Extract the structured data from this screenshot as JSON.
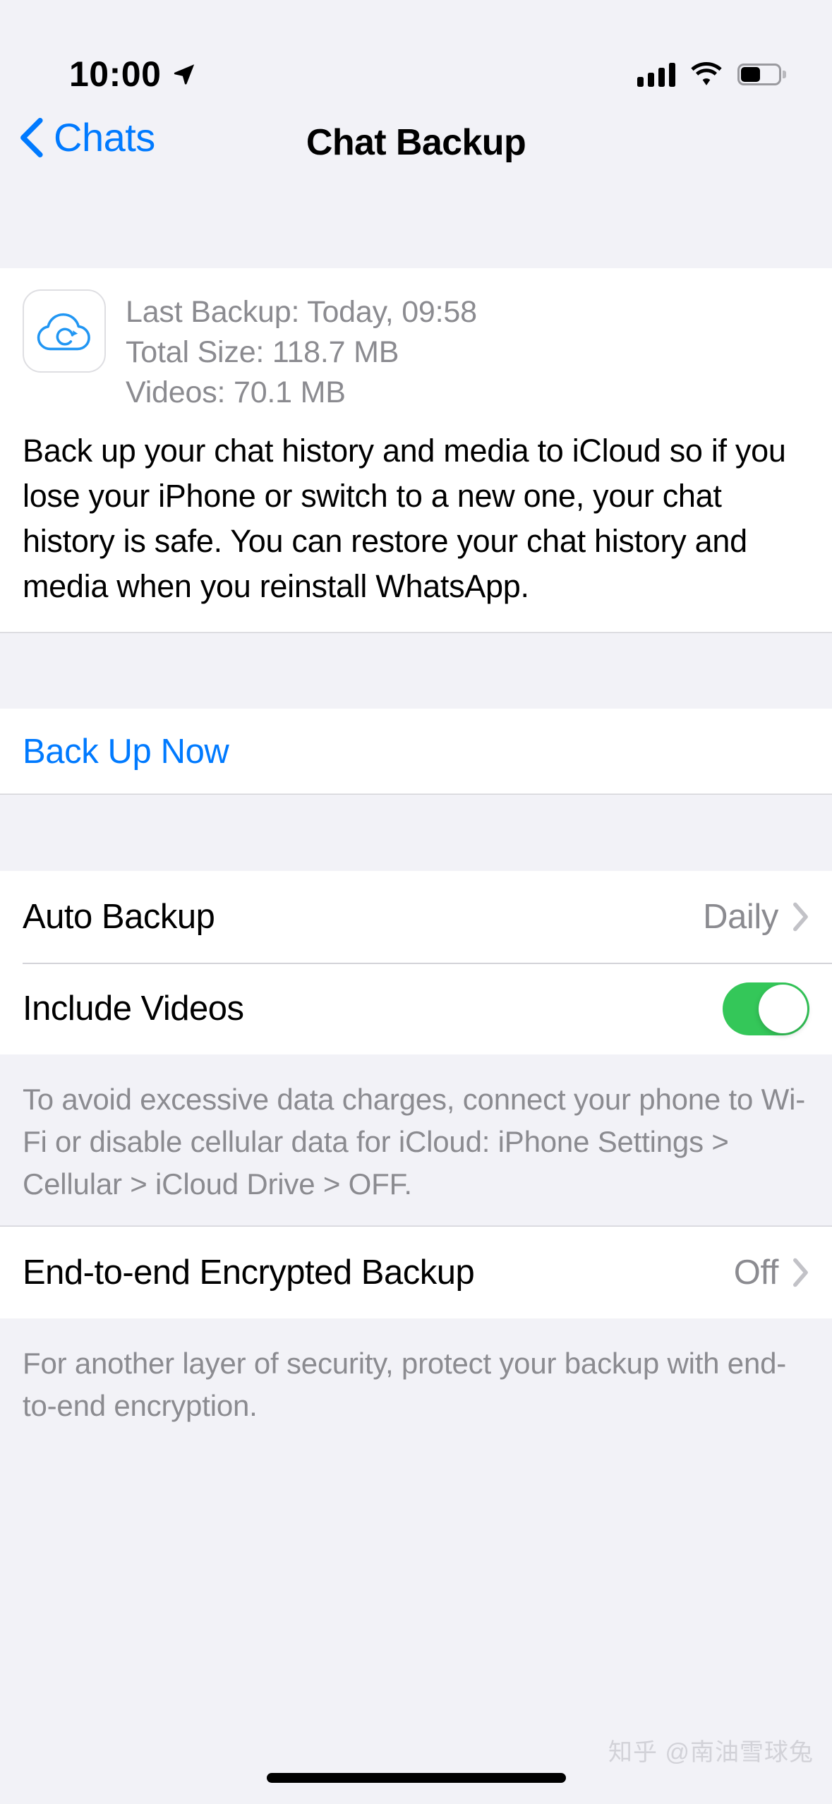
{
  "status_bar": {
    "time": "10:00",
    "location_icon": "location-arrow-icon",
    "cellular_icon": "cellular-signal-icon",
    "wifi_icon": "wifi-icon",
    "battery_icon": "battery-icon"
  },
  "nav": {
    "back_label": "Chats",
    "back_icon": "chevron-left-icon",
    "title": "Chat Backup"
  },
  "backup_info": {
    "icon": "cloud-backup-icon",
    "last_backup": "Last Backup: Today, 09:58",
    "total_size": "Total Size: 118.7 MB",
    "videos": "Videos: 70.1 MB",
    "description": "Back up your chat history and media to iCloud so if you lose your iPhone or switch to a new one, your chat history is safe. You can restore your chat history and media when you reinstall WhatsApp."
  },
  "actions": {
    "back_up_now": "Back Up Now"
  },
  "settings": {
    "auto_backup": {
      "label": "Auto Backup",
      "value": "Daily",
      "chevron_icon": "chevron-right-icon"
    },
    "include_videos": {
      "label": "Include Videos",
      "enabled": true,
      "toggle_icon": "toggle-switch-on-icon"
    },
    "data_note": "To avoid excessive data charges, connect your phone to Wi-Fi or disable cellular data for iCloud: iPhone Settings > Cellular > iCloud Drive > OFF.",
    "e2e_backup": {
      "label": "End-to-end Encrypted Backup",
      "value": "Off",
      "chevron_icon": "chevron-right-icon"
    },
    "e2e_note": "For another layer of security, protect your backup with end-to-end encryption."
  },
  "watermark": "知乎 @南油雪球兔",
  "colors": {
    "accent_blue": "#007aff",
    "toggle_green": "#34c759",
    "background": "#f2f2f7",
    "card": "#ffffff",
    "secondary_text": "#8b8b90"
  }
}
